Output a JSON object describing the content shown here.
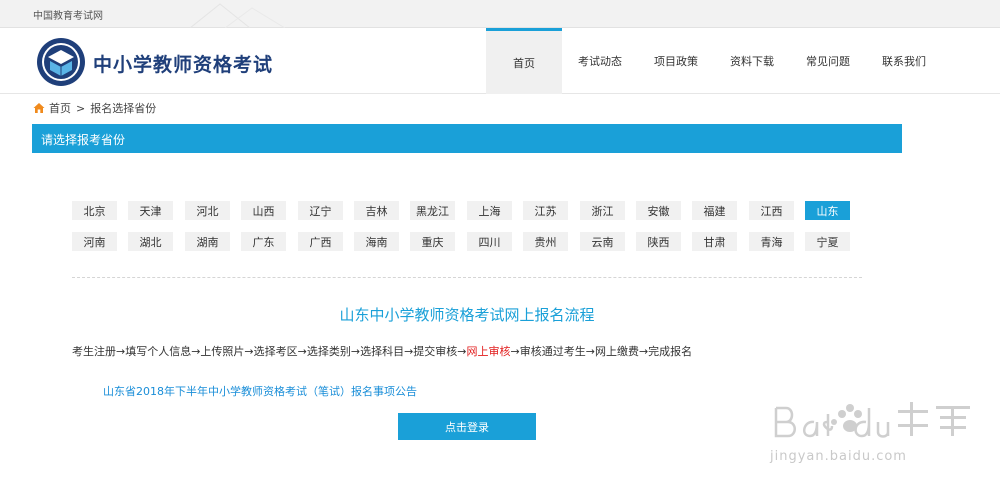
{
  "topbar": {
    "site_name": "中国教育考试网"
  },
  "header": {
    "brand": "中小学教师资格考试",
    "nav": [
      {
        "label": "首页",
        "active": true
      },
      {
        "label": "考试动态",
        "active": false
      },
      {
        "label": "项目政策",
        "active": false
      },
      {
        "label": "资料下载",
        "active": false
      },
      {
        "label": "常见问题",
        "active": false
      },
      {
        "label": "联系我们",
        "active": false
      }
    ]
  },
  "breadcrumb": {
    "home": "首页",
    "separator": ">",
    "current": "报名选择省份"
  },
  "section": {
    "title": "请选择报考省份"
  },
  "provinces": [
    "北京",
    "天津",
    "河北",
    "山西",
    "辽宁",
    "吉林",
    "黑龙江",
    "上海",
    "江苏",
    "浙江",
    "安徽",
    "福建",
    "江西",
    "山东",
    "河南",
    "湖北",
    "湖南",
    "广东",
    "广西",
    "海南",
    "重庆",
    "四川",
    "贵州",
    "云南",
    "陕西",
    "甘肃",
    "青海",
    "宁夏"
  ],
  "selected_province": "山东",
  "flow": {
    "title": "山东中小学教师资格考试网上报名流程",
    "before": "考生注册→填写个人信息→上传照片→选择考区→选择类别→选择科目→提交审核→",
    "highlight": "网上审核",
    "after": "→审核通过考生→网上缴费→完成报名"
  },
  "notice": {
    "label": "山东省2018年下半年中小学教师资格考试（笔试）报名事项公告"
  },
  "login_button": {
    "label": "点击登录"
  },
  "watermark": {
    "brand": "Bai du 经验",
    "url": "jingyan.baidu.com"
  },
  "colors": {
    "accent": "#1aa0d8",
    "brand_text": "#1f3f7a",
    "highlight": "#e21c1c"
  }
}
